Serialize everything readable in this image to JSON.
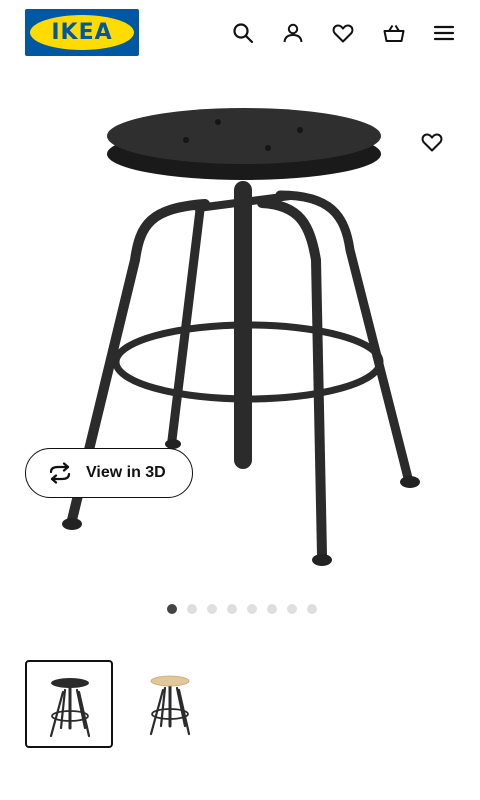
{
  "header": {
    "logo_text": "IKEA",
    "icons": [
      "search-icon",
      "account-icon",
      "favourites-icon",
      "shopping-bag-icon",
      "menu-icon"
    ]
  },
  "product": {
    "favourite_icon": "heart-outline-icon",
    "view_3d_label": "View in 3D",
    "view_3d_icon": "rotate-3d-icon"
  },
  "gallery": {
    "total_images": 8,
    "active_index": 0
  },
  "thumbnails": [
    {
      "name": "stool-black",
      "selected": true
    },
    {
      "name": "stool-pine",
      "selected": false
    }
  ],
  "colors": {
    "ikea_blue": "#0058a3",
    "ikea_yellow": "#ffdb00",
    "stool_black": "#2b2b2b",
    "stool_pine": "#e2c79a"
  }
}
